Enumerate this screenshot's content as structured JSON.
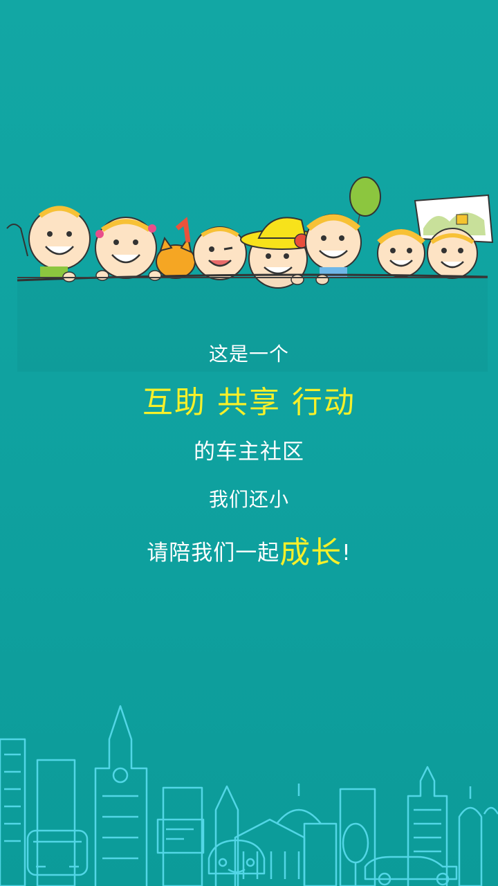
{
  "splash": {
    "line1": "这是一个",
    "line2": "互助 共享 行动",
    "line3": "的车主社区",
    "line4": "我们还小",
    "line5_prefix": "请陪我们一起",
    "line5_emphasis": "成长",
    "line5_suffix": "!"
  },
  "colors": {
    "background": "#0fa19f",
    "accent": "#f6f02a",
    "text": "#ffffff",
    "city_outline": "#52d6e6"
  }
}
